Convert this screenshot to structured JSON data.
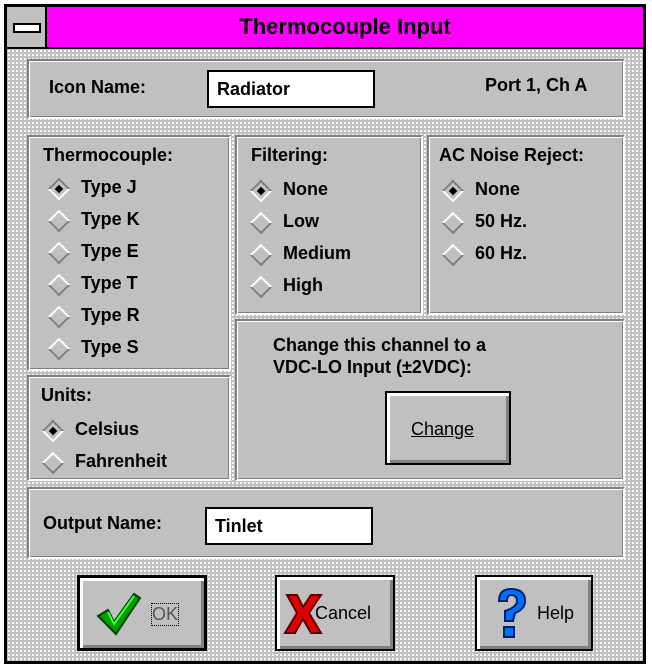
{
  "window": {
    "title": "Thermocouple Input"
  },
  "icon_name": {
    "label": "Icon Name:",
    "value": "Radiator",
    "port": "Port 1, Ch A"
  },
  "thermocouple": {
    "label": "Thermocouple:",
    "options": [
      "Type J",
      "Type K",
      "Type E",
      "Type T",
      "Type R",
      "Type S"
    ],
    "selected": "Type J"
  },
  "filtering": {
    "label": "Filtering:",
    "options": [
      "None",
      "Low",
      "Medium",
      "High"
    ],
    "selected": "None"
  },
  "ac_noise": {
    "label": "AC Noise Reject:",
    "options": [
      "None",
      "50 Hz.",
      "60 Hz."
    ],
    "selected": "None"
  },
  "units": {
    "label": "Units:",
    "options": [
      "Celsius",
      "Fahrenheit"
    ],
    "selected": "Celsius"
  },
  "change_channel": {
    "line1": "Change this channel to a",
    "line2": "VDC-LO Input (±2VDC):",
    "button": "Change"
  },
  "output_name": {
    "label": "Output Name:",
    "value": "Tinlet"
  },
  "buttons": {
    "ok": "OK",
    "cancel": "Cancel",
    "help": "Help"
  },
  "icons": {
    "ok": "checkmark-icon",
    "cancel": "red-x-icon",
    "help": "question-mark-icon"
  },
  "colors": {
    "titlebar": "#ff00ff",
    "face": "#c0c0c0"
  }
}
